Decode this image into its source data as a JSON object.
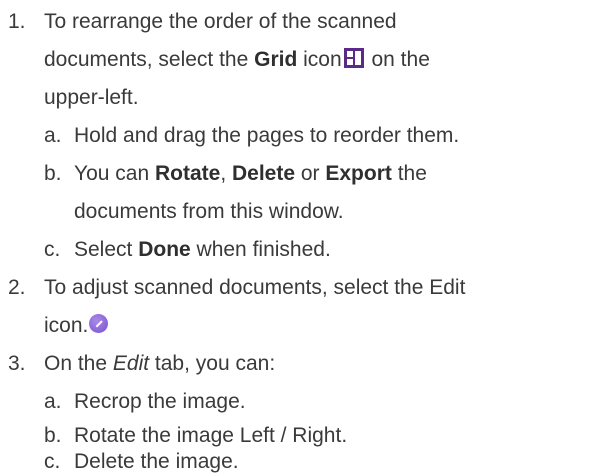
{
  "steps": [
    {
      "number": "1.",
      "lines": {
        "l1": "To rearrange the order of the scanned",
        "l2_a": "documents, select the ",
        "l2_bold": "Grid",
        "l2_b": " icon",
        "l2_c": " on the",
        "l3": "upper-left."
      },
      "icon": "grid-icon",
      "substeps": [
        {
          "marker": "a.",
          "text": "Hold and drag the pages to reorder them."
        },
        {
          "marker": "b.",
          "t1": "You can ",
          "b1": "Rotate",
          "t2": ", ",
          "b2": "Delete",
          "t3": " or ",
          "b3": "Export",
          "t4": " the",
          "l2": "documents from this window."
        },
        {
          "marker": "c.",
          "t1": "Select ",
          "b1": "Done",
          "t2": " when finished."
        }
      ]
    },
    {
      "number": "2.",
      "lines": {
        "l1": "To adjust scanned documents, select the Edit",
        "l2": "icon."
      },
      "icon": "edit-icon"
    },
    {
      "number": "3.",
      "lines": {
        "l1_a": "On the ",
        "l1_italic": "Edit",
        "l1_b": " tab, you can:"
      },
      "substeps": [
        {
          "marker": "a.",
          "text": "Recrop the image."
        },
        {
          "marker": "b.",
          "text": "Rotate the image Left / Right."
        },
        {
          "marker": "c.",
          "text": "Delete the image."
        }
      ]
    }
  ],
  "colors": {
    "text": "#3a3a3a",
    "grid_icon": "#5b2a86",
    "edit_icon": "#7a4fd1"
  }
}
